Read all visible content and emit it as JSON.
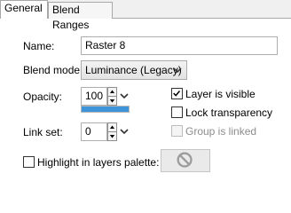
{
  "tabs": [
    {
      "label": "General",
      "active": true
    },
    {
      "label": "Blend Ranges",
      "active": false
    }
  ],
  "name": {
    "label": "Name:",
    "value": "Raster 8"
  },
  "blend_mode": {
    "label": "Blend mode:",
    "value": "Luminance (Legacy)"
  },
  "opacity": {
    "label": "Opacity:",
    "value": "100",
    "level": 1.0
  },
  "link_set": {
    "label": "Link set:",
    "value": "0"
  },
  "checkboxes": {
    "layer_visible": {
      "label": "Layer is visible",
      "checked": true,
      "enabled": true
    },
    "lock_transparency": {
      "label": "Lock transparency",
      "checked": false,
      "enabled": true
    },
    "group_linked": {
      "label": "Group is linked",
      "checked": false,
      "enabled": false
    },
    "highlight": {
      "label": "Highlight in layers palette:",
      "checked": false,
      "enabled": true
    }
  },
  "highlight_color_icon": "no-color-icon"
}
